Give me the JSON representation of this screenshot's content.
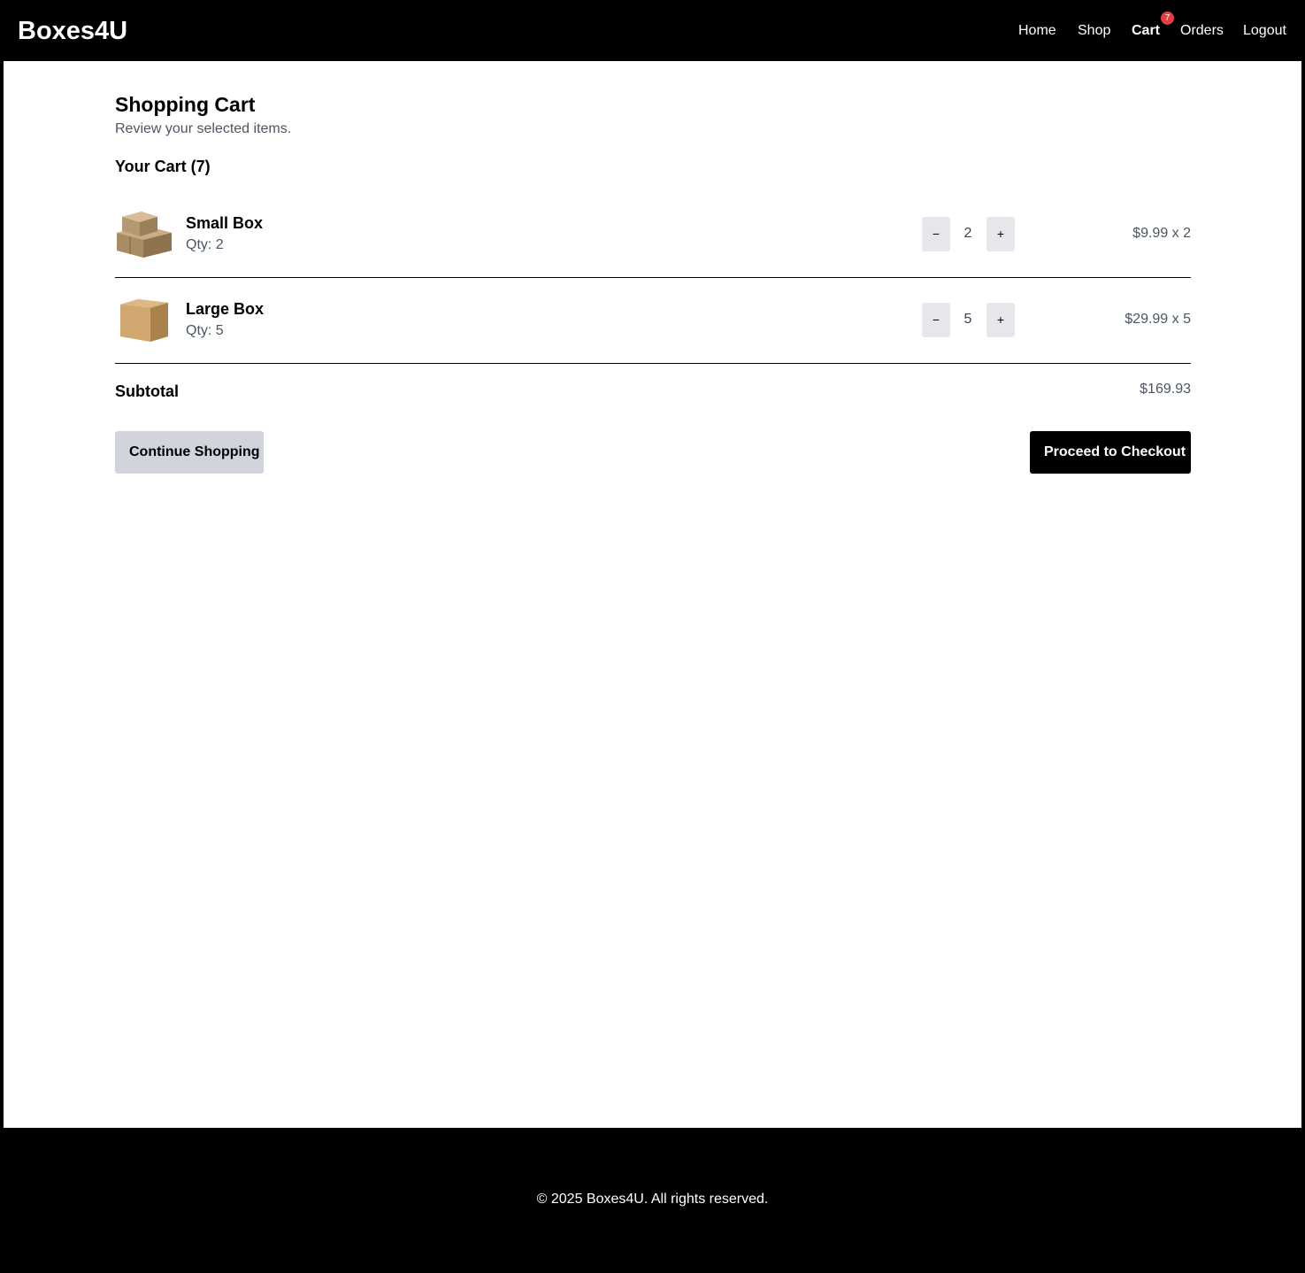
{
  "brand": "Boxes4U",
  "nav": {
    "home": "Home",
    "shop": "Shop",
    "cart": "Cart",
    "cart_badge": "7",
    "orders": "Orders",
    "logout": "Logout"
  },
  "colors": {
    "badge": "#e53e3e",
    "secondary_button": "#d1d5db",
    "stepper": "#e5e7eb"
  },
  "page": {
    "title": "Shopping Cart",
    "subtitle": "Review your selected items.",
    "cart_heading": "Your Cart (7)"
  },
  "items": [
    {
      "name": "Small Box",
      "qty_text": "Qty: 2",
      "qty": "2",
      "minus": "−",
      "plus": "+",
      "line_price": "$9.99 x 2",
      "icon": "stacked-boxes-image"
    },
    {
      "name": "Large Box",
      "qty_text": "Qty: 5",
      "qty": "5",
      "minus": "−",
      "plus": "+",
      "line_price": "$29.99 x 5",
      "icon": "single-box-image"
    }
  ],
  "summary": {
    "subtotal_label": "Subtotal",
    "subtotal_value": "$169.93"
  },
  "actions": {
    "continue": "Continue Shopping",
    "checkout": "Proceed to Checkout"
  },
  "footer": {
    "text": "© 2025 Boxes4U. All rights reserved."
  }
}
